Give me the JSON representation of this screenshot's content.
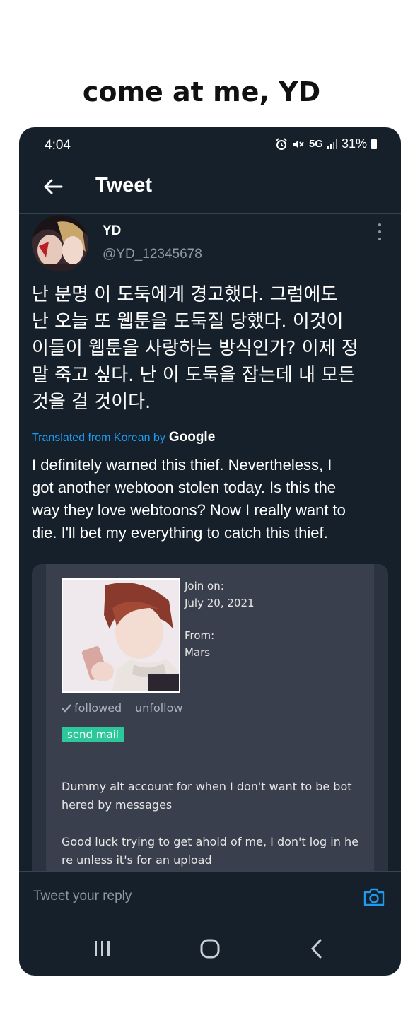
{
  "caption": "come at me, YD",
  "status_bar": {
    "time": "4:04",
    "network": "5G",
    "battery": "31%"
  },
  "header": {
    "title": "Tweet"
  },
  "tweet": {
    "display_name": "YD",
    "handle": "@YD_12345678",
    "korean_lines": [
      "난 분명 이 도둑에게 경고했다. 그럼에도",
      "난 오늘 또 웹툰을 도둑질 당했다. 이것이",
      "이들이 웹툰을 사랑하는 방식인가? 이제 정",
      "말 죽고 싶다. 난 이 도둑을 잡는데 내 모든",
      "것을 걸 것이다."
    ],
    "translated_from": "Translated from Korean by",
    "translator": "Google",
    "english_lines": [
      "I definitely warned this thief. Nevertheless, I",
      "got another webtoon stolen today. Is this the",
      "way they love webtoons? Now I really want to",
      "die. I'll bet my everything to catch this thief."
    ]
  },
  "card": {
    "join_label": "Join on:",
    "join_date": "July 20, 2021",
    "from_label": "From:",
    "from_value": "Mars",
    "followed_label": "followed",
    "unfollow_label": "unfollow",
    "send_mail_label": "send mail",
    "bio_1_lines": [
      "Dummy alt account for when I don't want to be bot",
      "hered by messages"
    ],
    "bio_2_lines": [
      "Good luck trying to get ahold of me, I don't log in he",
      "re unless it's for an upload"
    ]
  },
  "reply": {
    "placeholder": "Tweet your reply"
  },
  "icons": {
    "back": "arrow-left-icon",
    "more": "more-vertical-icon",
    "camera": "camera-icon",
    "alarm": "alarm-icon",
    "mute": "mute-icon",
    "signal": "signal-icon",
    "battery": "battery-icon",
    "check": "check-icon",
    "nav_recents": "recents-icon",
    "nav_home": "home-icon",
    "nav_back": "back-icon"
  },
  "colors": {
    "background": "#15202b",
    "accent": "#1d9bf0",
    "send_mail": "#2cc79b",
    "card": "#393f4c"
  }
}
